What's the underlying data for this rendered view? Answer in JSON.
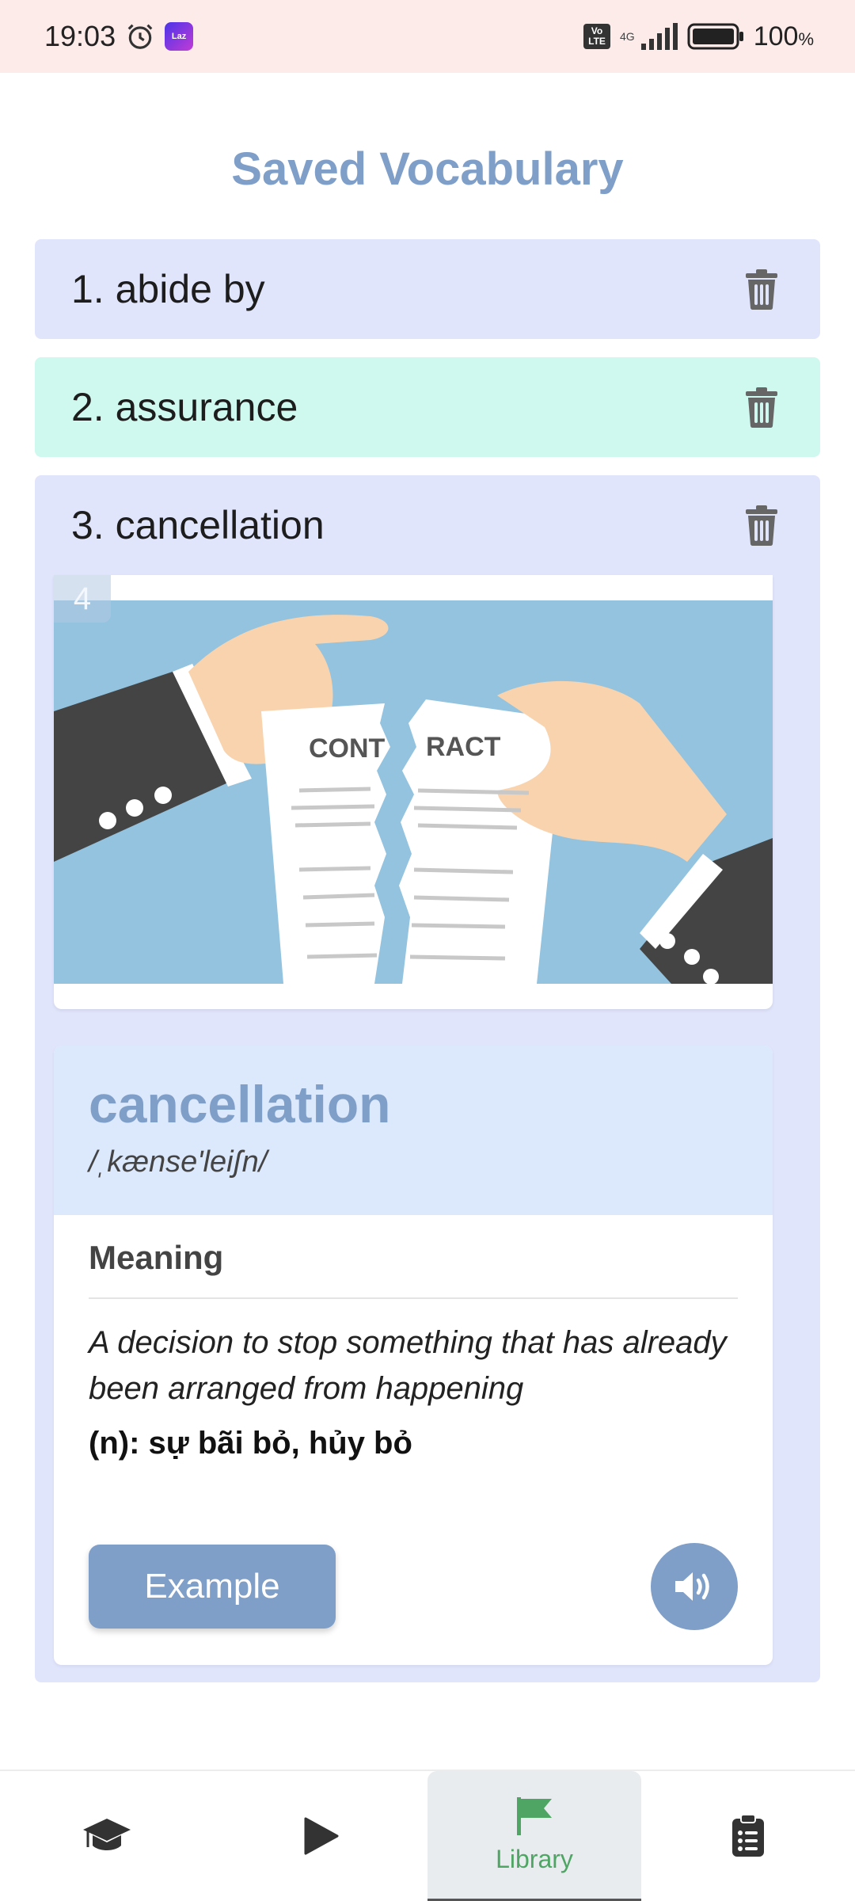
{
  "status_bar": {
    "time": "19:03",
    "app_badge": "Laz",
    "volte_top": "Vo",
    "volte_bottom": "LTE",
    "network": "4G",
    "battery": "100",
    "battery_unit": "%"
  },
  "page": {
    "title": "Saved Vocabulary"
  },
  "vocab_list": [
    {
      "label": "1. abide by",
      "color": "#e1e5fc"
    },
    {
      "label": "2. assurance",
      "color": "#cff8ee"
    },
    {
      "label": "3. cancellation",
      "color": "#e1e5fc"
    }
  ],
  "detail": {
    "image_index": "4",
    "image_text_left": "CONT",
    "image_text_right": "RACT",
    "word": "cancellation",
    "ipa": "/ˌkænse'leiʃn/",
    "meaning_label": "Meaning",
    "meaning": "A decision to stop something that has already been arranged from happening",
    "translation": "(n): sự bãi bỏ, hủy bỏ",
    "example_button": "Example"
  },
  "bottom_nav": {
    "items": [
      {
        "icon": "graduation-cap-icon",
        "label": ""
      },
      {
        "icon": "play-icon",
        "label": ""
      },
      {
        "icon": "flag-icon",
        "label": "Library",
        "active": true
      },
      {
        "icon": "clipboard-icon",
        "label": ""
      }
    ]
  },
  "colors": {
    "accent": "#7f9fc9",
    "active_nav": "#4fa564",
    "status_bar_bg": "#fdebea"
  }
}
